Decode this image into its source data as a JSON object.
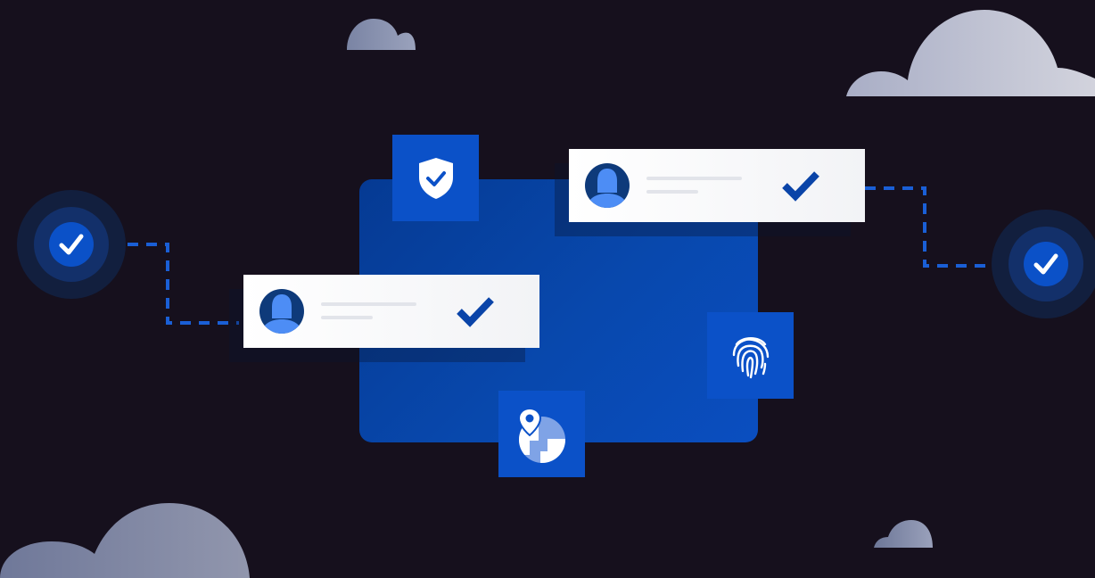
{
  "scene": {
    "colors": {
      "background": "#16101d",
      "panel": "#0848ad",
      "tile": "#0b51c8",
      "check": "#0a44a8",
      "avatar_dark": "#0e3a7a",
      "avatar_light": "#4d8df5",
      "connector": "#1a5fd6",
      "cloud_light": "#c8cad8",
      "cloud_dark": "#7b86a5"
    },
    "icons": [
      "shield-check-icon",
      "fingerprint-icon",
      "location-map-icon",
      "user-avatar-icon",
      "checkmark-icon",
      "verified-badge-icon",
      "cloud-icon"
    ]
  }
}
